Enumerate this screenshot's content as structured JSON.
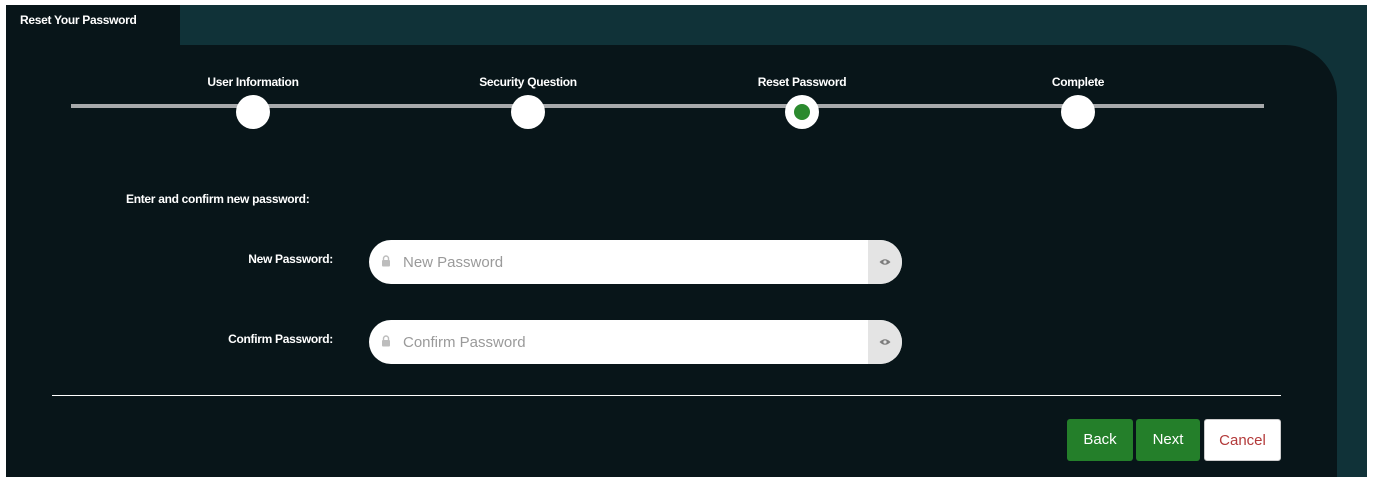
{
  "tab": {
    "title": "Reset Your Password"
  },
  "steps": [
    {
      "label": "User Information",
      "active": false
    },
    {
      "label": "Security Question",
      "active": false
    },
    {
      "label": "Reset Password",
      "active": true
    },
    {
      "label": "Complete",
      "active": false
    }
  ],
  "form": {
    "instruction": "Enter and confirm new password:",
    "new_password": {
      "label": "New Password:",
      "placeholder": "New Password",
      "value": ""
    },
    "confirm_password": {
      "label": "Confirm Password:",
      "placeholder": "Confirm Password",
      "value": ""
    }
  },
  "buttons": {
    "back": "Back",
    "next": "Next",
    "cancel": "Cancel"
  },
  "colors": {
    "background_dark": "#081519",
    "background_teal": "#103238",
    "accent_green": "#247f2a",
    "active_dot": "#2b8a2e",
    "cancel_text": "#b33a3a"
  },
  "icons": {
    "input_prefix": "lock-icon",
    "input_suffix": "eye-icon"
  }
}
